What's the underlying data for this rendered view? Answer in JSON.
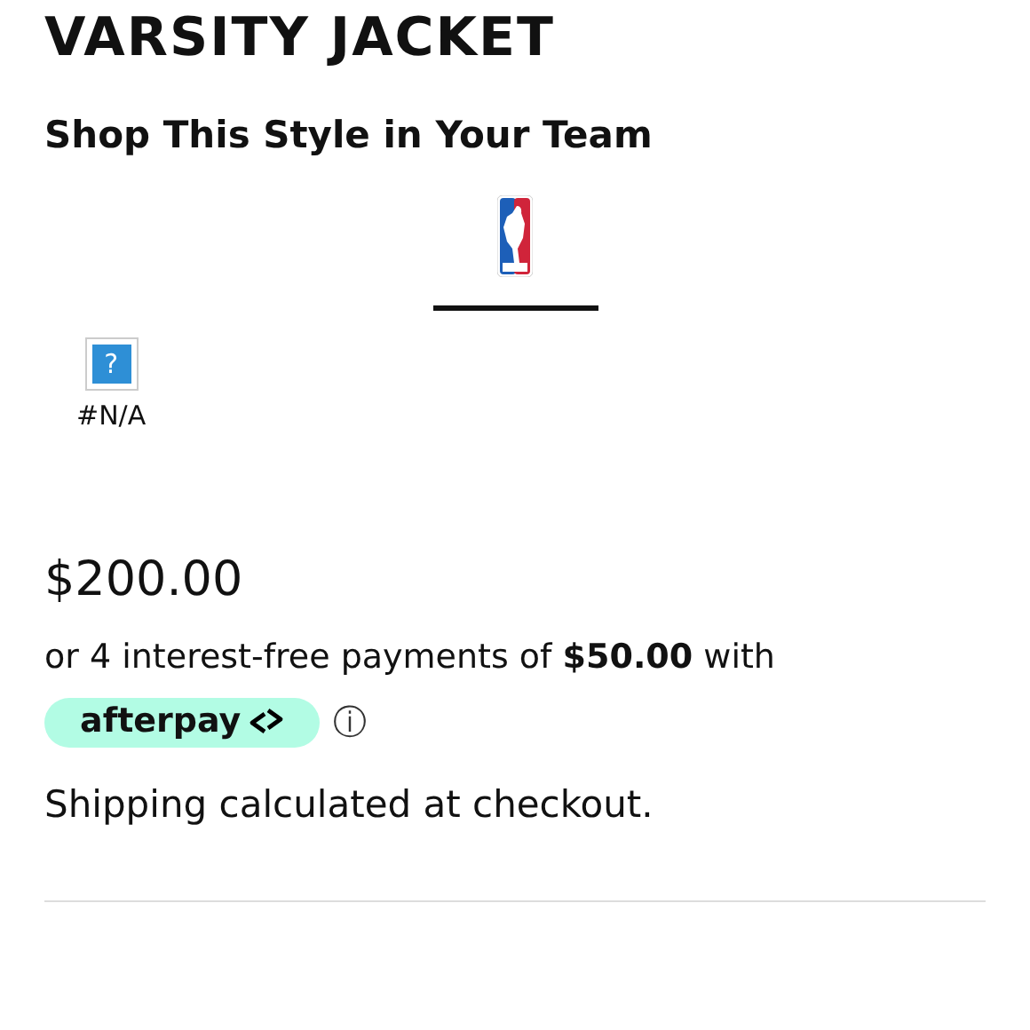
{
  "product": {
    "title": "VARSITY JACKET"
  },
  "team_section": {
    "heading": "Shop This Style in Your Team",
    "tabs": [
      {
        "kind": "league",
        "selected": true
      }
    ],
    "teams": [
      {
        "glyph": "?",
        "label": "#N/A"
      }
    ]
  },
  "price": "$200.00",
  "installments": {
    "text": "or 4 interest-free payments of **$50.00** with",
    "provider": "afterpay",
    "info_glyph": "ⓘ"
  },
  "shipping_note": "Shipping calculated at checkout."
}
